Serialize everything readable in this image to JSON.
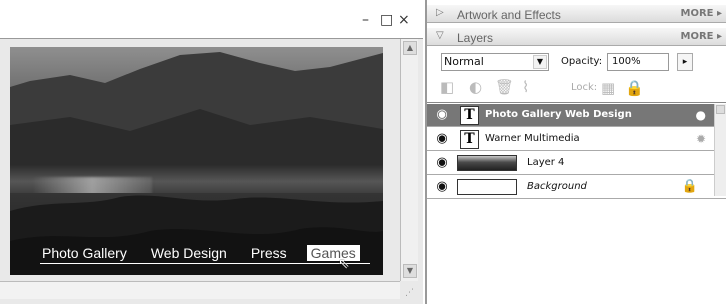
{
  "window": {
    "minimize": "–",
    "maximize": "□",
    "close": "×"
  },
  "website": {
    "nav": [
      "Photo Gallery",
      "Web Design",
      "Press",
      "Games"
    ]
  },
  "panels": {
    "artwork": {
      "title": "Artwork and Effects",
      "more": "MORE ▸"
    },
    "layers": {
      "title": "Layers",
      "more": "MORE ▸",
      "blend_mode": "Normal",
      "opacity_label": "Opacity:",
      "opacity_value": "100%",
      "lock_label": "Lock:",
      "items": [
        {
          "name": "Photo Gallery   Web Design",
          "type": "text",
          "selected": true
        },
        {
          "name": "Warner Multimedia",
          "type": "text"
        },
        {
          "name": "Layer 4",
          "type": "image"
        },
        {
          "name": "Background",
          "type": "background",
          "locked": true
        }
      ]
    }
  }
}
